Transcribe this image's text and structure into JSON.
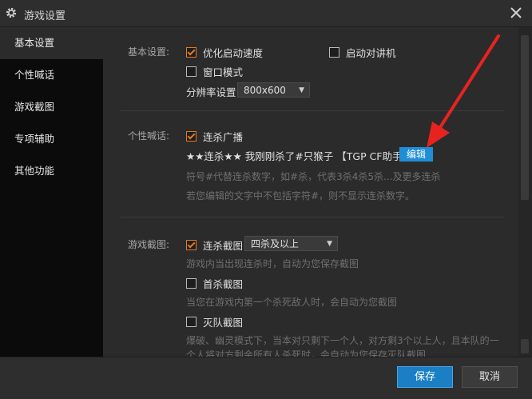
{
  "window": {
    "title": "游戏设置"
  },
  "sidebar": {
    "items": [
      {
        "label": "基本设置",
        "active": true
      },
      {
        "label": "个性喊话",
        "active": false
      },
      {
        "label": "游戏截图",
        "active": false
      },
      {
        "label": "专项辅助",
        "active": false
      },
      {
        "label": "其他功能",
        "active": false
      }
    ]
  },
  "basic": {
    "label": "基本设置:",
    "optimize_startup": {
      "label": "优化启动速度",
      "checked": true
    },
    "start_walkie": {
      "label": "启动对讲机",
      "checked": false
    },
    "window_mode": {
      "label": "窗口模式",
      "checked": false
    },
    "resolution_label": "分辨率设置",
    "resolution_value": "800x600"
  },
  "shout": {
    "label": "个性喊话:",
    "killstreak_broadcast": {
      "label": "连杀广播",
      "checked": true
    },
    "message": "★★连杀★★ 我刚刚杀了#只猴子 【TGP CF助手】",
    "edit_label": "编辑",
    "hint1": "符号#代替连杀数字，如#杀，代表3杀4杀5杀...及更多连杀",
    "hint2": "若您编辑的文字中不包括字符#，则不显示连杀数字。"
  },
  "screenshot": {
    "label": "游戏截图:",
    "killstreak_shot": {
      "label": "连杀截图",
      "checked": true
    },
    "killstreak_select": "四杀及以上",
    "hint1": "游戏内当出现连杀时，自动为您保存截图",
    "first_kill": {
      "label": "首杀截图",
      "checked": false
    },
    "hint2": "当您在游戏内第一个杀死敌人时，会自动为您截图",
    "ace": {
      "label": "灭队截图",
      "checked": false
    },
    "hint3": "爆破、幽灵模式下，当本对只剩下一个人，对方剩3个以上人，且本队的一",
    "hint4": "个人将对方剩余所有人杀死时，会自动为您保存灭队截图"
  },
  "footer": {
    "save_label": "保存",
    "cancel_label": "取消"
  },
  "colors": {
    "accent_blue": "#1a7fc4",
    "check_orange": "#e07b28",
    "annotation_red": "#e8231f"
  },
  "icons": {
    "title": "gear-icon",
    "close": "close-icon"
  }
}
